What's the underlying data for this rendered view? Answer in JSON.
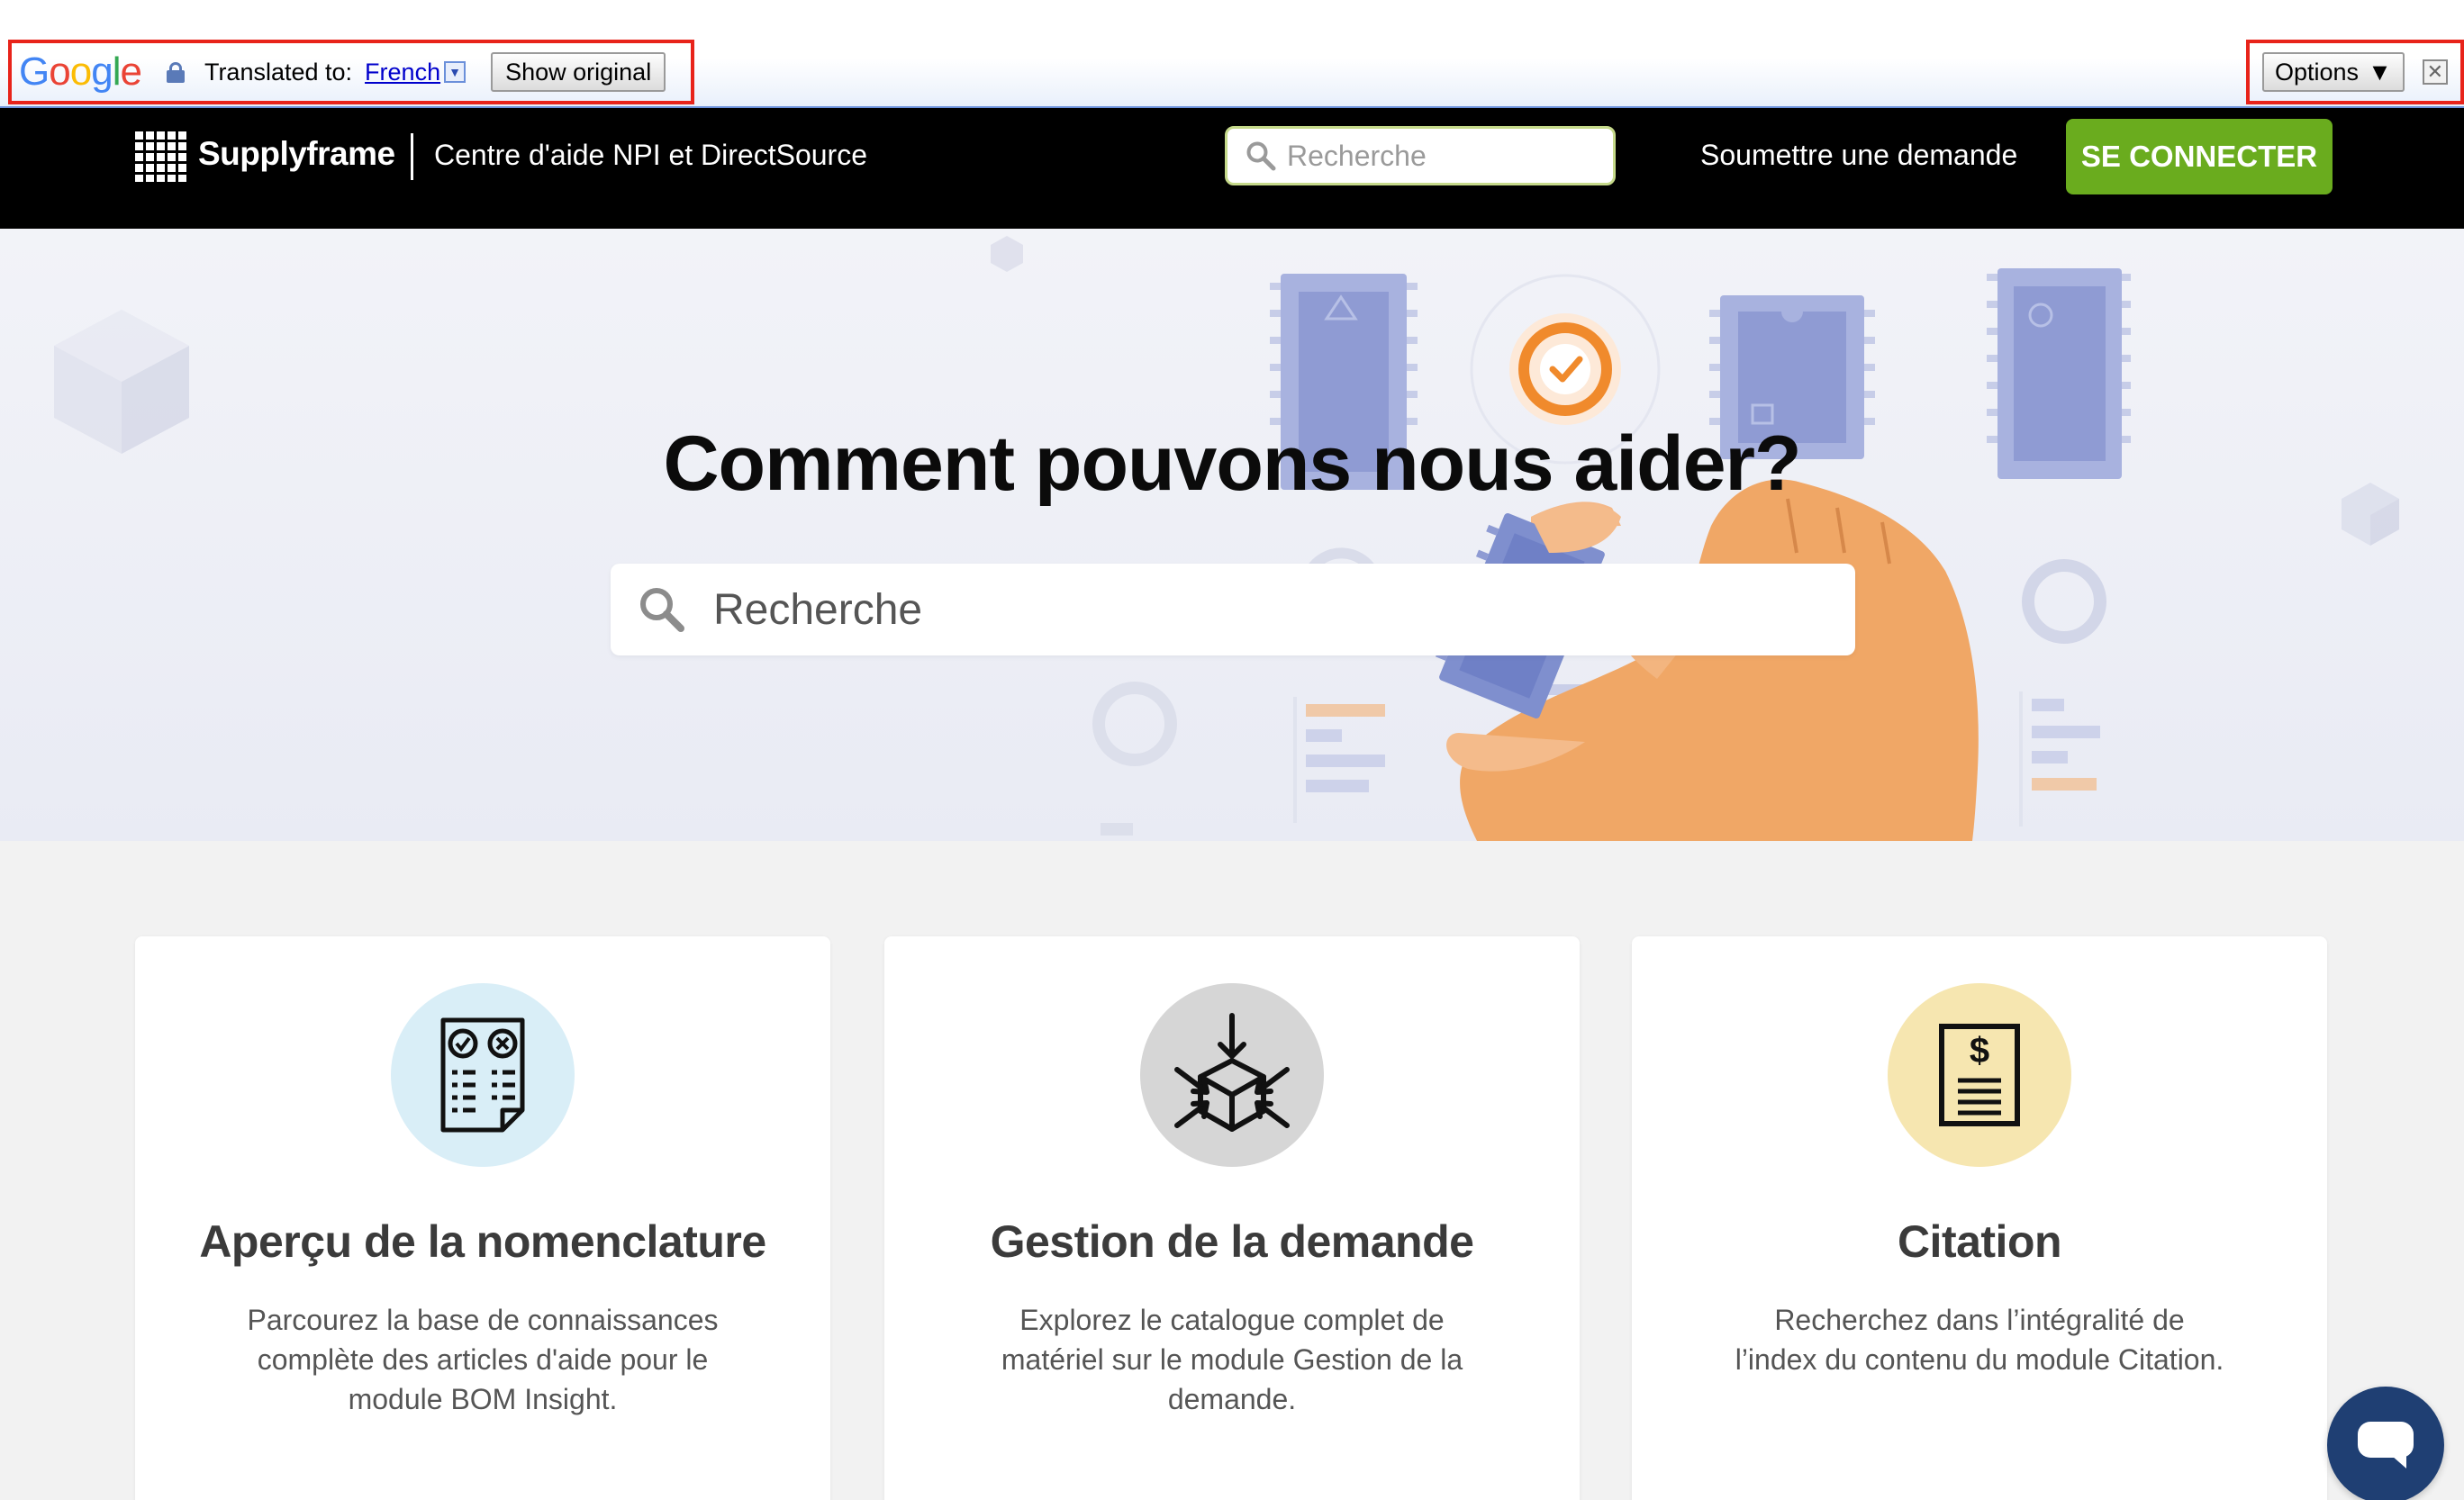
{
  "translate_bar": {
    "logo_letters": [
      "G",
      "o",
      "o",
      "g",
      "l",
      "e"
    ],
    "translated_to_label": "Translated to:",
    "language": "French",
    "language_dropdown_icon": "chevron-down-icon",
    "show_original_label": "Show original",
    "options_label": "Options",
    "options_arrow": "▼",
    "close_symbol": "✕"
  },
  "nav": {
    "brand": "Supplyframe",
    "site_title": "Centre d'aide NPI et DirectSource",
    "search_placeholder": "Recherche",
    "submit_request": "Soumettre une demande",
    "login": "SE CONNECTER"
  },
  "hero": {
    "title": "Comment pouvons nous aider?",
    "search_placeholder": "Recherche"
  },
  "cards": [
    {
      "title": "Aperçu de la nomenclature",
      "description": "Parcourez la base de connaissances complète des articles d'aide pour le module BOM Insight.",
      "icon": "checklist-document-icon",
      "circle_color": "#d9eef7"
    },
    {
      "title": "Gestion de la demande",
      "description": "Explorez le catalogue complet de matériel sur le module Gestion de la demande.",
      "icon": "box-arrows-icon",
      "circle_color": "#d6d6d6"
    },
    {
      "title": "Citation",
      "description": "Recherchez dans l’intégralité de l’index du contenu du module Citation.",
      "icon": "dollar-document-icon",
      "circle_color": "#f6e6b0"
    }
  ],
  "colors": {
    "nav_bg": "#000000",
    "login_green": "#6aac1e",
    "highlight_red": "#e8231a",
    "chat_blue": "#1f3f73"
  },
  "chat": {
    "icon": "chat-bubble-icon"
  }
}
